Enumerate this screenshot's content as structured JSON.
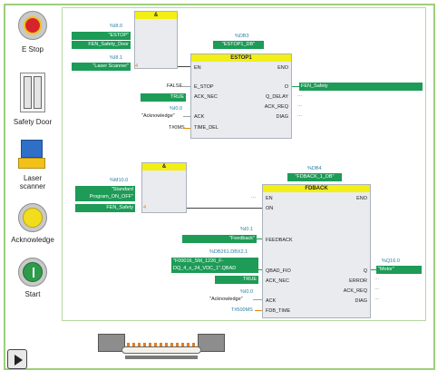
{
  "sidebar": {
    "estop_label": "E Stop",
    "safety_door_label": "Safety Door",
    "laser_scanner_label": "Laser\nscanner",
    "acknowledge_label": "Acknowledge",
    "start_label": "Start"
  },
  "and_block_1": {
    "title": "&",
    "in1_addr": "%I8.0",
    "in1_tag": "\"ESTOP\"",
    "in2_tag": "FEN_Safety_Door",
    "in3_addr": "%I8.1",
    "in3_tag": "\"Laser Scanner\"",
    "in3_connector": "4"
  },
  "estop_block": {
    "db_addr": "%DB3",
    "db_name": "\"ESTOP1_DB\"",
    "title": "ESTOP1",
    "pin_en": "EN",
    "pin_eno": "ENO",
    "pin_e_stop": "E_STOP",
    "pin_o": "O",
    "pin_ack_nec": "ACK_NEC",
    "pin_q_delay": "Q_DELAY",
    "pin_ack_req": "ACK_REQ",
    "pin_ack": "ACK",
    "pin_diag": "DIAG",
    "pin_time_del": "TIME_DEL",
    "val_false": "FALSE",
    "val_true": "TRUE",
    "ack_addr": "%I0.0",
    "ack_tag": "\"Acknowledge\"",
    "time_val": "T#0MS",
    "out_o_tag": "FEN_Safety",
    "out_dots": "..."
  },
  "and_block_2": {
    "title": "&",
    "in1_addr": "%M10.0",
    "in1_tag": "\"Standard Program_ON_OFF\"",
    "in2_tag": "FEN_Safety",
    "in2_connector": "4"
  },
  "fdback_block": {
    "db_addr": "%DB4",
    "db_name": "\"FDBACK_1_DB\"",
    "title": "FDBACK",
    "pin_en": "EN",
    "pin_eno": "ENO",
    "pin_on": "ON",
    "pin_feedback": "FEEDBACK",
    "pin_qbad_fio": "QBAD_FIO",
    "pin_q": "Q",
    "pin_ack_nec": "ACK_NEC",
    "pin_error": "ERROR",
    "pin_ack_req": "ACK_REQ",
    "pin_ack": "ACK",
    "pin_diag": "DIAG",
    "pin_fdb_time": "FDB_TIME",
    "feedback_addr": "%I0.1",
    "feedback_tag": "\"Feedback\"",
    "qbad_addr": "%DB261.DBX2.1",
    "qbad_tag": "\"F00016_SM_1226_F-DQ_4_x_24_VDC_1\".QBAD",
    "val_true": "TRUE",
    "ack_addr": "%I0.0",
    "ack_tag": "\"Acknowledge\"",
    "time_val": "T#500MS",
    "q_addr": "%Q16.0",
    "q_tag": "\"Motor\"",
    "en_dots": "...",
    "out_dots": "..."
  },
  "colors": {
    "frame_green": "#9fcf7a",
    "tag_green": "#1d9b57",
    "block_header_yellow": "#f3ef16",
    "address_teal": "#2c7fa5",
    "estop_red": "#d7242b",
    "ack_yellow": "#f2dc1e",
    "start_green": "#2e9b4a"
  }
}
